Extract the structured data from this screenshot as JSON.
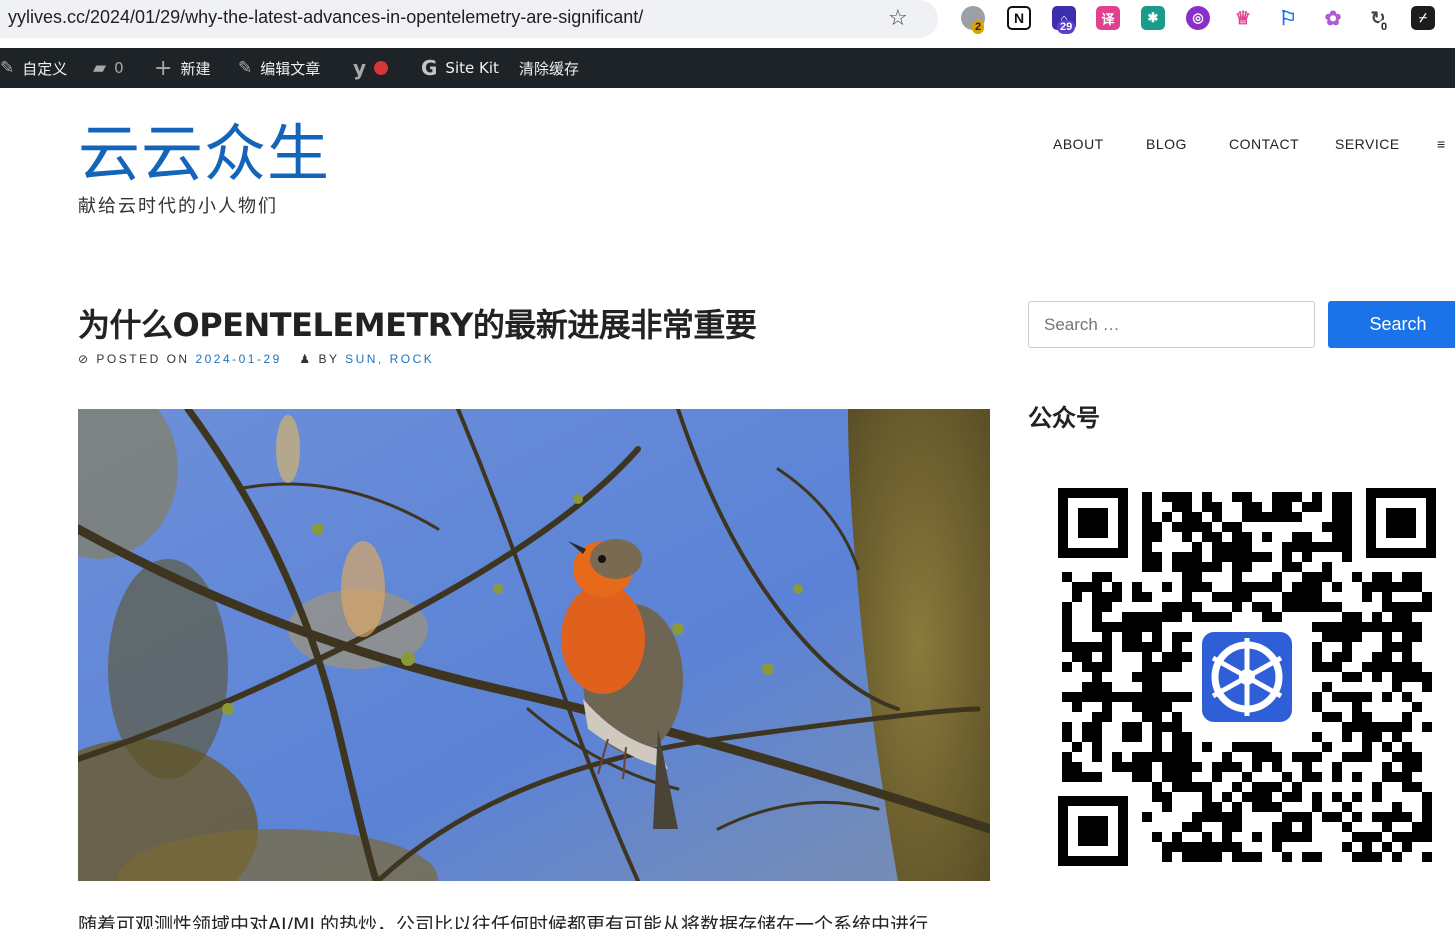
{
  "browser": {
    "url": "yylives.cc/2024/01/29/why-the-latest-advances-in-opentelemetry-are-significant/",
    "extensions": [
      {
        "name": "extension-1-icon",
        "badge": "2"
      },
      {
        "name": "notion-icon"
      },
      {
        "name": "extension-3-icon",
        "badge": "29"
      },
      {
        "name": "translate-icon"
      },
      {
        "name": "extension-5-icon"
      },
      {
        "name": "extension-6-icon"
      },
      {
        "name": "extension-7-icon"
      },
      {
        "name": "extension-8-icon"
      },
      {
        "name": "openai-icon"
      },
      {
        "name": "extension-10-icon",
        "badge": "0"
      },
      {
        "name": "extension-11-icon"
      }
    ]
  },
  "admin_bar": {
    "customize": "自定义",
    "comments_count": "0",
    "new": "新建",
    "edit_post": "编辑文章",
    "site_kit": "Site Kit",
    "clear_cache": "清除缓存"
  },
  "site": {
    "title": "云云众生",
    "description": "献给云时代的小人物们"
  },
  "nav": {
    "items": [
      "ABOUT",
      "BLOG",
      "CONTACT",
      "SERVICE"
    ],
    "menu_toggle": "≡"
  },
  "post": {
    "title": "为什么OPENTELEMETRY的最新进展非常重要",
    "posted_on_label": "POSTED ON",
    "date": "2024-01-29",
    "by_label": "BY",
    "author": "SUN, ROCK",
    "excerpt": "随着可观测性领域中对AI/ML的热炒，公司比以往任何时候都更有可能从将数据存储在一个系统中进行"
  },
  "sidebar": {
    "search_placeholder": "Search …",
    "search_button": "Search",
    "widget_title": "公众号"
  },
  "colors": {
    "accent": "#1a73e8",
    "site_title": "#1265b8",
    "admin_bar": "#1d2327",
    "link": "#1e73be"
  }
}
